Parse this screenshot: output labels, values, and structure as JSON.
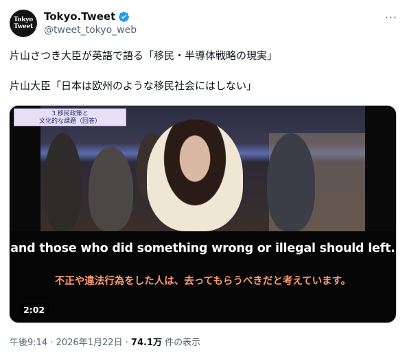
{
  "account": {
    "avatar_line1": "Tokyo",
    "avatar_line2": "Tweet",
    "display_name": "Tokyo.Tweet",
    "handle": "@tweet_tokyo_web",
    "verified_color": "#1d9bf0"
  },
  "tweet": {
    "line1": "片山さつき大臣が英語で語る「移民・半導体戦略の現実」",
    "line2": "片山大臣「日本は欧州のような移民社会にはしない」"
  },
  "video": {
    "overlay_line1": "3 移民政策と",
    "overlay_line2": "文化的な課題（回答）",
    "subtitle_en": "and those who did something wrong or illegal should left.",
    "subtitle_jp": "不正や違法行為をした人は、去ってもらうべきだと考えています。",
    "duration": "2:02"
  },
  "meta": {
    "time": "午後9:14",
    "date": "2026年1月22日",
    "views": "74.1万",
    "views_suffix": "件の表示"
  }
}
